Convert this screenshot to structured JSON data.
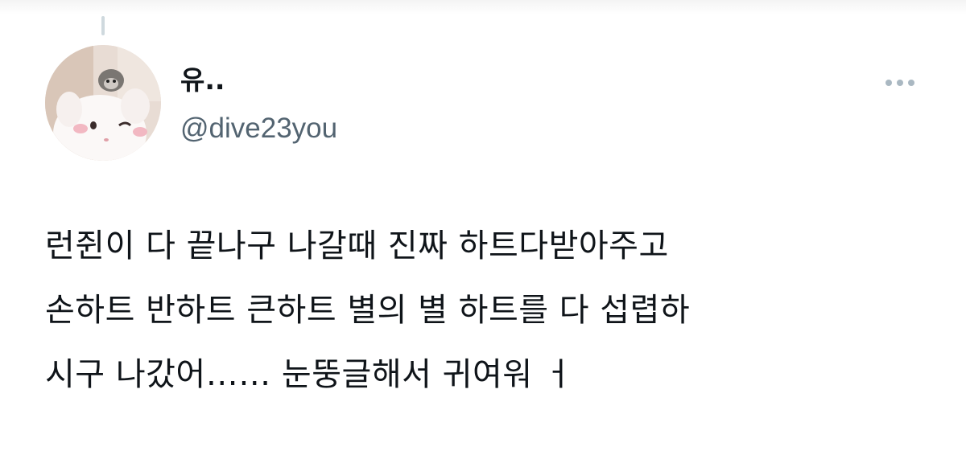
{
  "author": {
    "display_name": "유..",
    "handle": "@dive23you"
  },
  "tweet": {
    "lines": [
      "런쥔이 다 끝나구 나갈때 진짜 하트다받아주고",
      "손하트 반하트 큰하트 별의 별 하트를 다 섭렵하",
      "시구 나갔어…… 눈뚱글해서 귀여워 ㅓ"
    ]
  },
  "icons": {
    "more": "more-horizontal-icon",
    "avatar": "avatar-image"
  },
  "colors": {
    "text": "#0f1419",
    "secondary": "#536471",
    "icon_muted": "#aab8c2",
    "thread_line": "#cfd9de"
  }
}
